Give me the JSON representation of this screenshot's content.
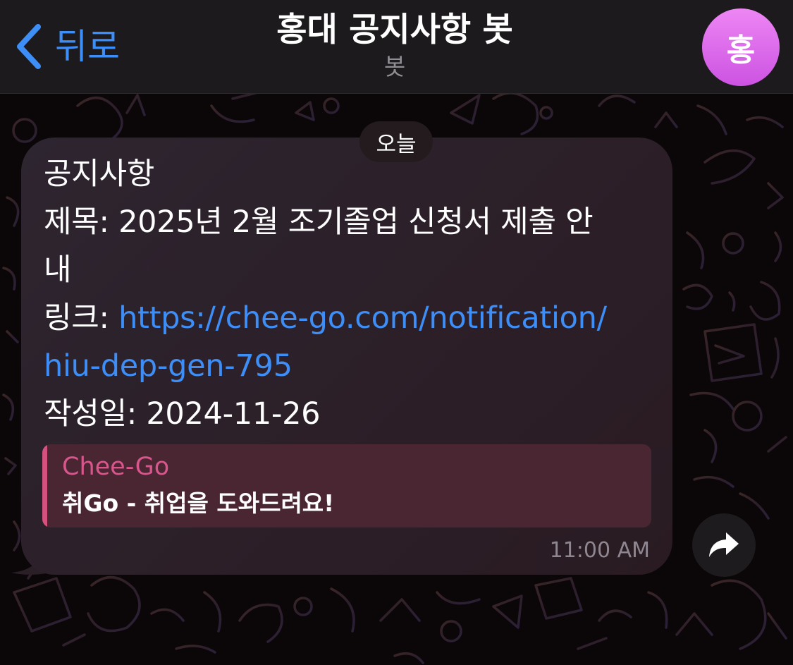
{
  "header": {
    "back_label": "뒤로",
    "title": "홍대 공지사항 봇",
    "subtitle": "봇",
    "avatar_letter": "홍"
  },
  "date_chip": "오늘",
  "message": {
    "lines": [
      "공지사항",
      "제목: 2025년 2월 조기졸업 신청서 제출 안",
      "내",
      "링크: ",
      "작성일: 2024-11-26"
    ],
    "link_line1": "https://chee-go.com/notification/",
    "link_line2": "hiu-dep-gen-795",
    "time": "11:00 AM"
  },
  "link_preview": {
    "site_name": "Chee-Go",
    "title": "취Go - 취업을 도와드려요!"
  },
  "colors": {
    "accent": "#3e8ef7",
    "preview_accent": "#d6527e",
    "avatar_top": "#ee86f4",
    "avatar_bottom": "#cc53e2"
  },
  "icons": {
    "back": "chevron-left-icon",
    "share": "share-arrow-icon"
  }
}
